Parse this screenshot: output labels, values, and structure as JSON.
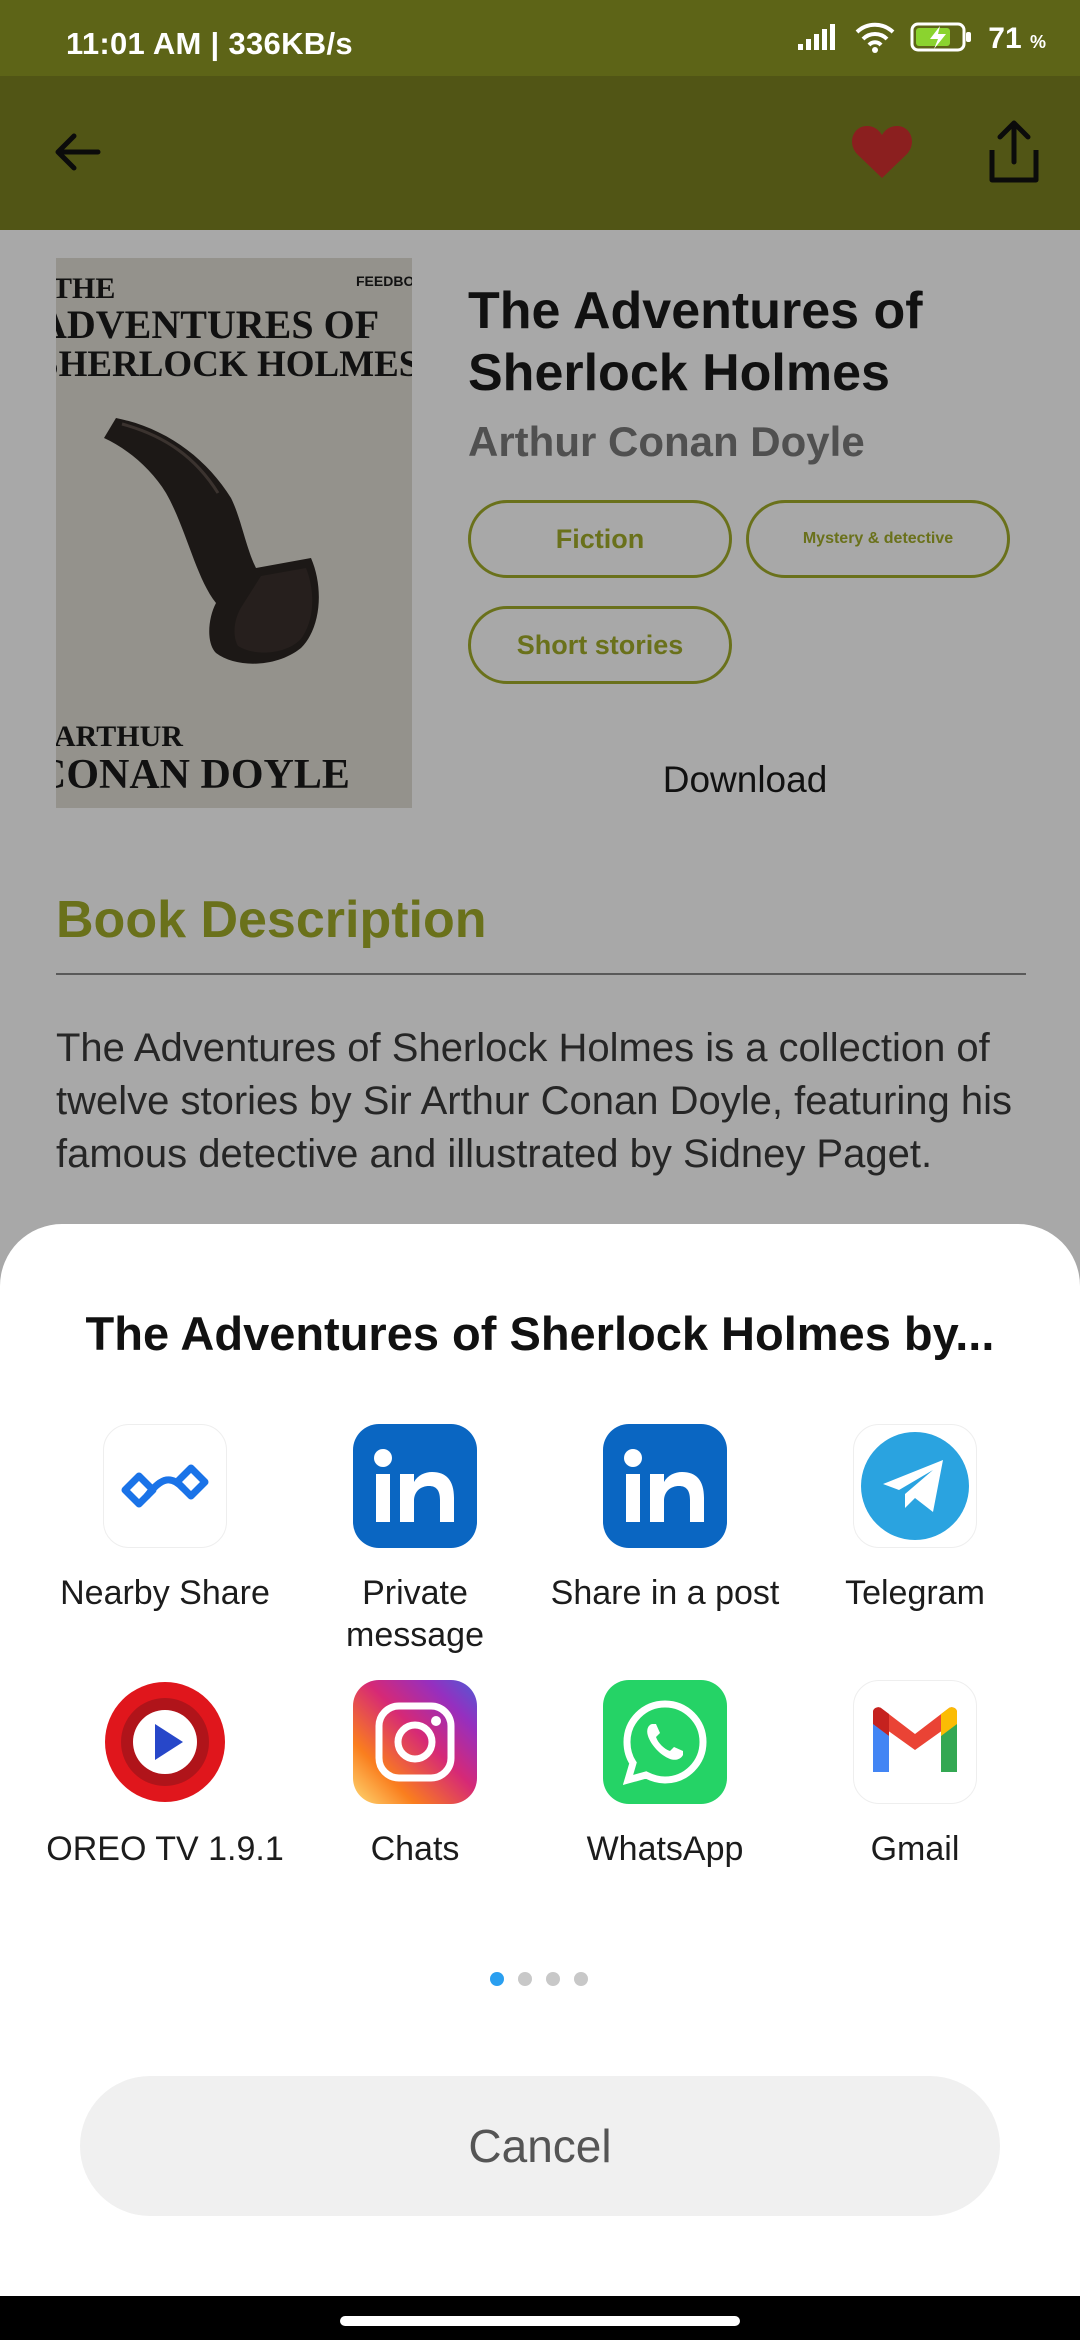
{
  "status_bar": {
    "time": "11:01 AM | 336KB/s",
    "battery_percent": "71",
    "battery_unit": "%",
    "icons": [
      "signal-icon",
      "wifi-icon",
      "battery-charging-icon"
    ]
  },
  "app_bar": {
    "back_icon": "arrow-left-icon",
    "favorite_icon": "heart-icon",
    "share_icon": "share-icon",
    "favorite_color": "#d32f2f",
    "background": "#7c8220"
  },
  "book": {
    "title": "The Adventures of Sherlock Holmes",
    "author": "Arthur Conan Doyle",
    "cover": {
      "top_line_1": "THE",
      "top_line_2": "ADVENTURES OF",
      "top_line_3": "SHERLOCK HOLMES",
      "publisher": "FEEDBOOKS",
      "bottom_line_1": "ARTHUR",
      "bottom_line_2": "CONAN DOYLE"
    },
    "genres": [
      "Fiction",
      "Mystery & detective",
      "Short stories"
    ],
    "download_label": "Download",
    "description_heading": "Book Description",
    "description": "The Adventures of Sherlock Holmes is a collection of twelve stories by Sir Arthur Conan Doyle, featuring his famous detective and illustrated by Sidney Paget."
  },
  "share_sheet": {
    "title": "The Adventures of Sherlock Holmes by...",
    "apps": [
      {
        "label": "Nearby Share",
        "icon": "nearby-share-icon"
      },
      {
        "label": "Private message",
        "icon": "linkedin-icon"
      },
      {
        "label": "Share in a post",
        "icon": "linkedin-icon"
      },
      {
        "label": "Telegram",
        "icon": "telegram-icon"
      },
      {
        "label": "OREO TV 1.9.1",
        "icon": "oreo-tv-icon"
      },
      {
        "label": "Chats",
        "icon": "instagram-icon"
      },
      {
        "label": "WhatsApp",
        "icon": "whatsapp-icon"
      },
      {
        "label": "Gmail",
        "icon": "gmail-icon"
      }
    ],
    "page_count": 4,
    "active_page": 1,
    "cancel_label": "Cancel"
  },
  "colors": {
    "accent": "#a2ac2a",
    "status_bar": "#5d6417",
    "linkedin": "#0a66c2",
    "telegram": "#2aa3e0",
    "whatsapp": "#25d366",
    "page_dot_active": "#2a9ff0"
  }
}
